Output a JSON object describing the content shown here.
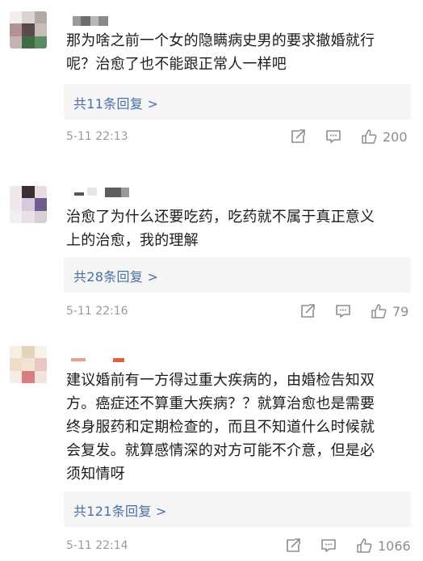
{
  "comments": [
    {
      "text_lines": [
        "那为啥之前一个女的隐瞒病史男的要求撤婚就行",
        "呢？治愈了也不能跟正常人一样吧"
      ],
      "replies_label": "共11条回复 >",
      "time": "5-11 22:13",
      "likes": "200",
      "icons": [
        "share-icon",
        "comment-icon",
        "like-icon"
      ]
    },
    {
      "text_lines": [
        "治愈了为什么还要吃药，吃药就不属于真正意义",
        "上的治愈，我的理解"
      ],
      "replies_label": "共28条回复 >",
      "time": "5-11 22:16",
      "likes": "79",
      "icons": [
        "share-icon",
        "comment-icon",
        "like-icon"
      ]
    },
    {
      "text_lines": [
        "建议婚前有一方得过重大疾病的，由婚检告知双",
        "方。癌症还不算重大疾病？？就算治愈也是需要",
        "终身服药和定期检查的，而且不知道什么时候就",
        "会复发。就算感情深的对方可能不介意，但是必",
        "须知情呀"
      ],
      "replies_label": "共121条回复 >",
      "time": "5-11 22:14",
      "likes": "1066",
      "icons": [
        "share-icon",
        "comment-icon",
        "like-icon"
      ]
    }
  ],
  "colors": {
    "reply_link": "#4a6fa5",
    "reply_bg": "#f5f5f6",
    "meta_text": "#9a9a9a"
  }
}
